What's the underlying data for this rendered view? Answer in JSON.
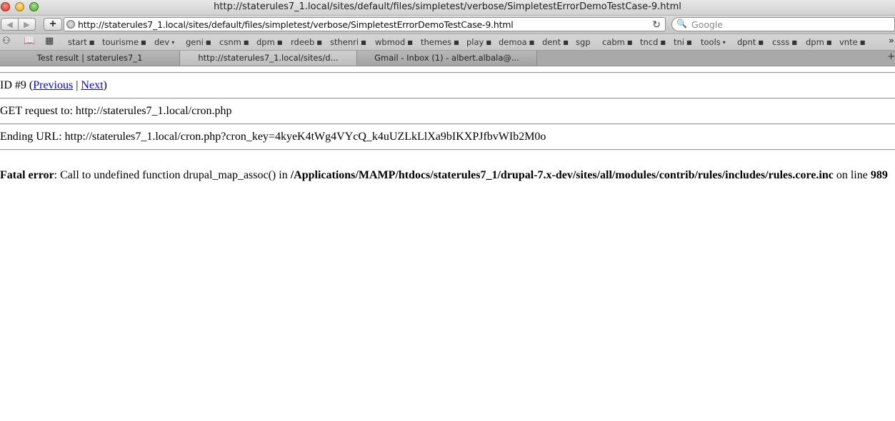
{
  "window": {
    "title": "http://staterules7_1.local/sites/default/files/simpletest/verbose/SimpletestErrorDemoTestCase-9.html"
  },
  "navbar": {
    "back_icon": "◀",
    "forward_icon": "▶",
    "add_icon": "+",
    "url": "http://staterules7_1.local/sites/default/files/simpletest/verbose/SimpletestErrorDemoTestCase-9.html",
    "reload_icon": "↻",
    "search_icon": "🔍",
    "search_placeholder": "Google"
  },
  "bookmarks": [
    {
      "label": "start",
      "marker": "■"
    },
    {
      "label": "tourisme",
      "marker": "■"
    },
    {
      "label": "dev",
      "marker": "▾"
    },
    {
      "label": "geni",
      "marker": "■"
    },
    {
      "label": "csnm",
      "marker": "■"
    },
    {
      "label": "dpm",
      "marker": "■"
    },
    {
      "label": "rdeeb",
      "marker": "■"
    },
    {
      "label": "sthenri",
      "marker": "■"
    },
    {
      "label": "wbmod",
      "marker": "■"
    },
    {
      "label": "themes",
      "marker": "■"
    },
    {
      "label": "play",
      "marker": "■"
    },
    {
      "label": "demoa",
      "marker": "■"
    },
    {
      "label": "dent",
      "marker": "■"
    },
    {
      "label": "sgp",
      "marker": ""
    },
    {
      "label": "cabm",
      "marker": "■"
    },
    {
      "label": "tncd",
      "marker": "■"
    },
    {
      "label": "tni",
      "marker": "■"
    },
    {
      "label": "tools",
      "marker": "▾"
    },
    {
      "label": "dpnt",
      "marker": "■"
    },
    {
      "label": "csss",
      "marker": "■"
    },
    {
      "label": "dpm",
      "marker": "■"
    },
    {
      "label": "vnte",
      "marker": "■"
    }
  ],
  "tabs": [
    {
      "label": "Test result | staterules7_1",
      "active": false
    },
    {
      "label": "http://staterules7_1.local/sites/d...",
      "active": true
    },
    {
      "label": "Gmail - Inbox (1) - albert.albala@...",
      "active": false
    }
  ],
  "page": {
    "id_text": "ID #9 (",
    "previous": "Previous",
    "sep": " | ",
    "next": "Next",
    "close_paren": ")",
    "get_request": "GET request to: http://staterules7_1.local/cron.php",
    "ending_url": "Ending URL: http://staterules7_1.local/cron.php?cron_key=4kyeK4tWg4VYcQ_k4uUZLkLlXa9bIKXPJfbvWIb2M0o",
    "error_label": "Fatal error",
    "error_msg": ": Call to undefined function drupal_map_assoc() in ",
    "error_path": "/Applications/MAMP/htdocs/staterules7_1/drupal-7.x-dev/sites/all/modules/contrib/rules/includes/rules.core.inc",
    "error_online": " on line ",
    "error_line": "989"
  }
}
